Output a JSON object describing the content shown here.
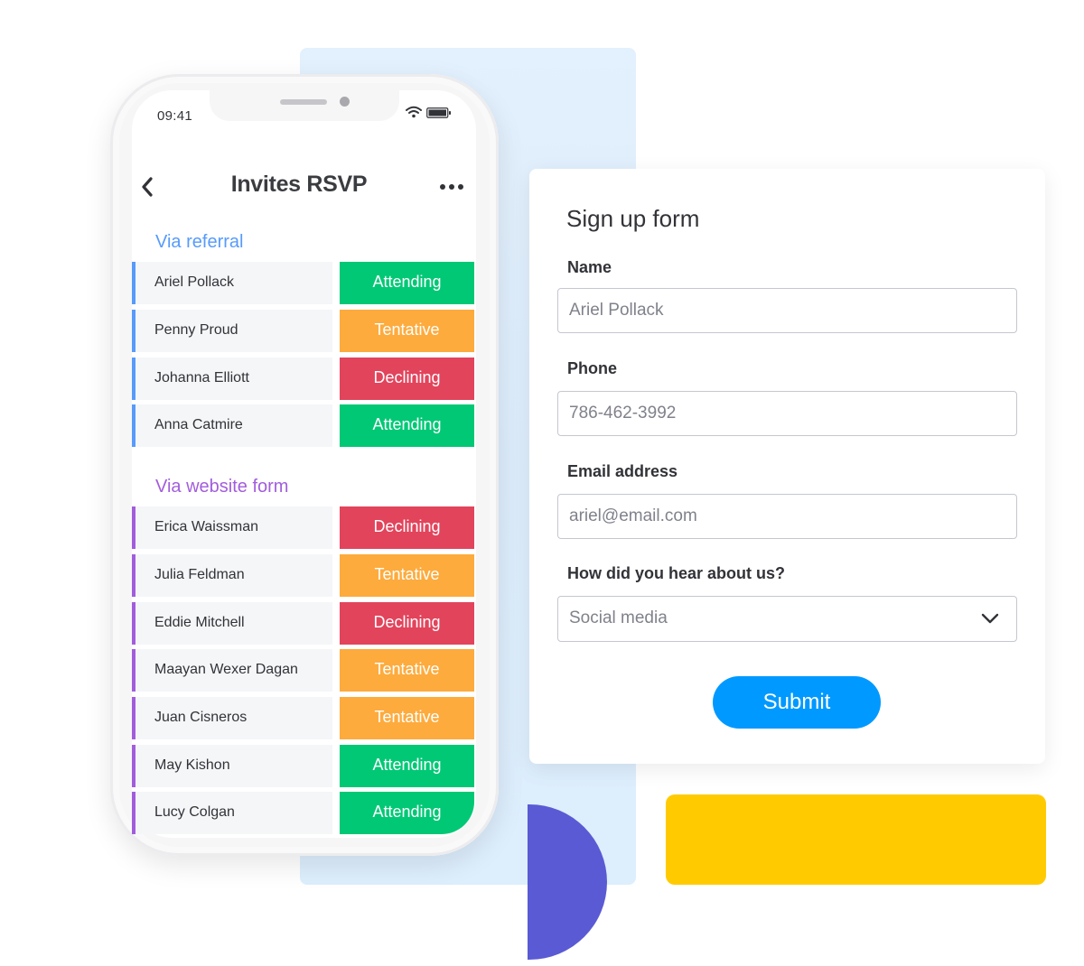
{
  "colors": {
    "attending": "#00c875",
    "tentative": "#fdab3d",
    "declining": "#e2445c",
    "referral_accent": "#579bfc",
    "website_accent": "#a25ddc",
    "submit": "#0099ff"
  },
  "phone": {
    "status_time": "09:41",
    "title": "Invites RSVP",
    "icons": {
      "back": "chevron-left-icon",
      "more": "more-horizontal-icon",
      "wifi": "wifi-icon",
      "battery": "battery-icon"
    },
    "groups": [
      {
        "title": "Via referral",
        "rows": [
          {
            "name": "Ariel Pollack",
            "status": "Attending"
          },
          {
            "name": "Penny Proud",
            "status": "Tentative"
          },
          {
            "name": "Johanna Elliott",
            "status": "Declining"
          },
          {
            "name": "Anna Catmire",
            "status": "Attending"
          }
        ]
      },
      {
        "title": "Via website form",
        "rows": [
          {
            "name": "Erica Waissman",
            "status": "Declining"
          },
          {
            "name": "Julia Feldman",
            "status": "Tentative"
          },
          {
            "name": "Eddie Mitchell",
            "status": "Declining"
          },
          {
            "name": "Maayan Wexer Dagan",
            "status": "Tentative"
          },
          {
            "name": "Juan Cisneros",
            "status": "Tentative"
          },
          {
            "name": "May Kishon",
            "status": "Attending"
          },
          {
            "name": "Lucy Colgan",
            "status": "Attending"
          }
        ]
      }
    ]
  },
  "form": {
    "title": "Sign up form",
    "fields": [
      {
        "label": "Name",
        "placeholder": "Ariel Pollack"
      },
      {
        "label": "Phone",
        "placeholder": "786-462-3992"
      },
      {
        "label": "Email address",
        "placeholder": "ariel@email.com"
      }
    ],
    "select": {
      "label": "How did you hear about us?",
      "value": "Social media",
      "icon": "chevron-down-icon"
    },
    "submit_label": "Submit"
  }
}
